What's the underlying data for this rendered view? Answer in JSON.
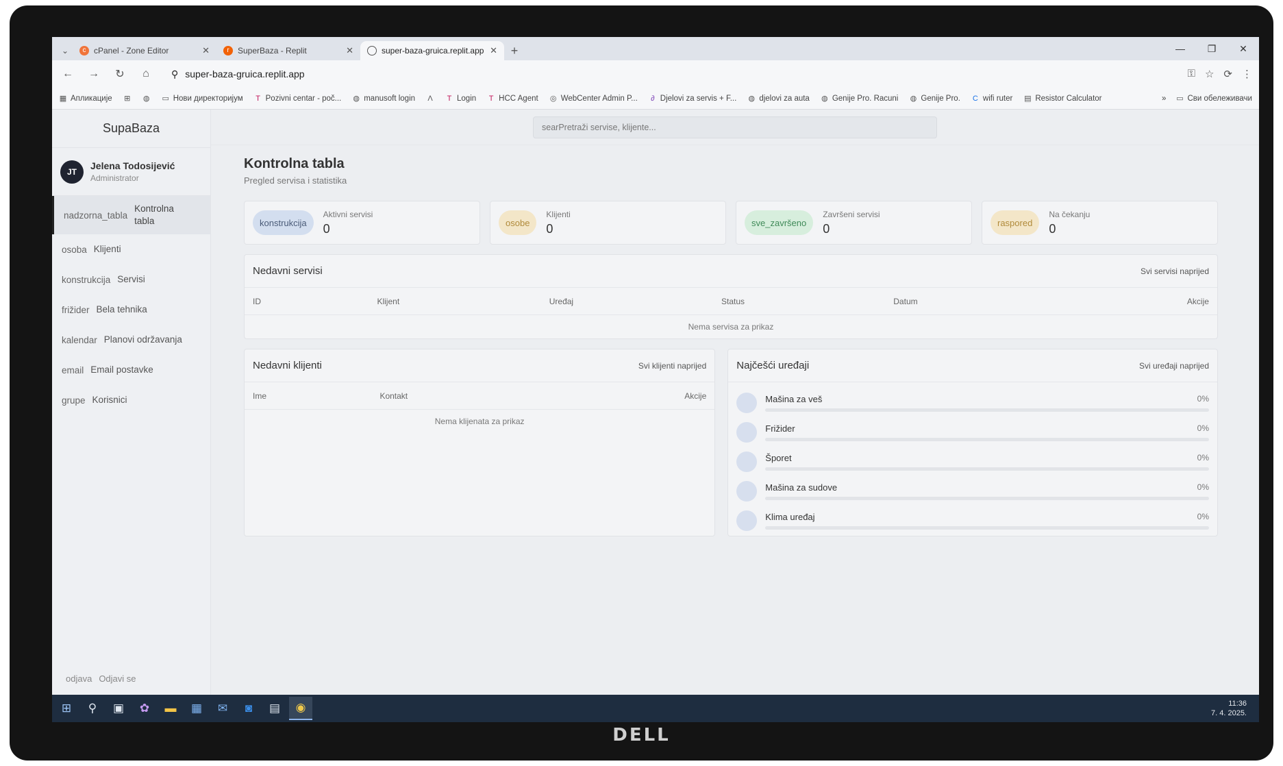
{
  "browser": {
    "tabs": [
      {
        "label": "cPanel - Zone Editor",
        "icon": "cpanel-icon",
        "active": false
      },
      {
        "label": "SuperBaza - Replit",
        "icon": "replit-icon",
        "active": false
      },
      {
        "label": "super-baza-gruica.replit.app",
        "icon": "globe-icon",
        "active": true
      }
    ],
    "url": "super-baza-gruica.replit.app",
    "bookmarks": [
      "Апликације",
      "Нови директоријум",
      "Pozivni centar - poč...",
      "manusoft login",
      "Login",
      "HCC Agent",
      "WebCenter Admin P...",
      "Djelovi za servis + F...",
      "djelovi za auta",
      "Genije Pro. Racuni",
      "Genije Pro.",
      "wifi ruter",
      "Resistor Calculator"
    ],
    "all_bookmarks": "Сви обележивачи"
  },
  "app": {
    "brand": "SupaBaza",
    "user": {
      "initials": "JT",
      "name": "Jelena Todosijević",
      "role": "Administrator"
    },
    "nav": [
      {
        "key": "nadzorna_tabla",
        "label": "Kontrolna tabla",
        "active": true
      },
      {
        "key": "osoba",
        "label": "Klijenti",
        "active": false
      },
      {
        "key": "konstrukcija",
        "label": "Servisi",
        "active": false
      },
      {
        "key": "frižider",
        "label": "Bela tehnika",
        "active": false
      },
      {
        "key": "kalendar",
        "label": "Planovi održavanja",
        "active": false
      },
      {
        "key": "email",
        "label": "Email postavke",
        "active": false
      },
      {
        "key": "grupe",
        "label": "Korisnici",
        "active": false
      }
    ],
    "logout": {
      "key": "odjava",
      "label": "Odjavi se"
    },
    "search_value": "searPretraži servise, klijente..."
  },
  "page": {
    "title": "Kontrolna tabla",
    "subtitle": "Pregled servisa i statistika"
  },
  "stats": [
    {
      "badge": "konstrukcija",
      "label": "Aktivni servisi",
      "value": "0",
      "color": "#d3deef",
      "text_color": "#4a5b78"
    },
    {
      "badge": "osobe",
      "label": "Klijenti",
      "value": "0",
      "color": "#f3e6c8",
      "text_color": "#b08a3a"
    },
    {
      "badge": "sve_završeno",
      "label": "Završeni servisi",
      "value": "0",
      "color": "#d7eedd",
      "text_color": "#3f8a58"
    },
    {
      "badge": "raspored",
      "label": "Na čekanju",
      "value": "0",
      "color": "#f3e6c8",
      "text_color": "#b08a3a"
    }
  ],
  "recent_services": {
    "title": "Nedavni servisi",
    "link": "Svi servisi naprijed",
    "columns": [
      "ID",
      "Klijent",
      "Uređaj",
      "Status",
      "Datum",
      "Akcije"
    ],
    "empty": "Nema servisa za prikaz"
  },
  "recent_clients": {
    "title": "Nedavni klijenti",
    "link": "Svi klijenti naprijed",
    "columns": [
      "Ime",
      "Kontakt",
      "Akcije"
    ],
    "empty": "Nema klijenata za prikaz"
  },
  "top_devices": {
    "title": "Najčešći uređaji",
    "link": "Svi uređaji naprijed",
    "items": [
      {
        "name": "Mašina za veš",
        "percent": "0%",
        "fraction": 0
      },
      {
        "name": "Frižider",
        "percent": "0%",
        "fraction": 0
      },
      {
        "name": "Šporet",
        "percent": "0%",
        "fraction": 0
      },
      {
        "name": "Mašina za sudove",
        "percent": "0%",
        "fraction": 0
      },
      {
        "name": "Klima uređaj",
        "percent": "0%",
        "fraction": 0
      }
    ]
  },
  "taskbar": {
    "time": "11:36",
    "date": "7. 4. 2025."
  },
  "monitor_brand": "DELL"
}
